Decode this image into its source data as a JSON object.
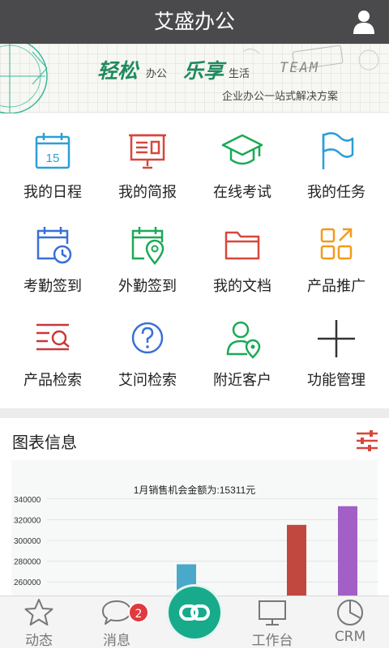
{
  "header": {
    "title": "艾盛办公",
    "user_icon": "user-icon"
  },
  "banner": {
    "word1": "轻松",
    "sub1": "办公",
    "word2": "乐享",
    "sub2": "生活",
    "team": "TEAM",
    "tagline": "企业办公一站式解决方案"
  },
  "grid": {
    "items": [
      {
        "label": "我的日程",
        "icon": "calendar-icon",
        "day": "15",
        "color": "#2b9fd8"
      },
      {
        "label": "我的简报",
        "icon": "presentation-icon",
        "color": "#d8463b"
      },
      {
        "label": "在线考试",
        "icon": "graduation-cap-icon",
        "color": "#1aaa55"
      },
      {
        "label": "我的任务",
        "icon": "flag-icon",
        "color": "#2b9fd8"
      },
      {
        "label": "考勤签到",
        "icon": "calendar-clock-icon",
        "color": "#3a6fd8"
      },
      {
        "label": "外勤签到",
        "icon": "calendar-location-icon",
        "color": "#1aaa55"
      },
      {
        "label": "我的文档",
        "icon": "folder-icon",
        "color": "#d8463b"
      },
      {
        "label": "产品推广",
        "icon": "apps-grid-icon",
        "color": "#f39a1e"
      },
      {
        "label": "产品检索",
        "icon": "list-search-icon",
        "color": "#c9383a"
      },
      {
        "label": "艾问检索",
        "icon": "question-circle-icon",
        "color": "#3a6fd8"
      },
      {
        "label": "附近客户",
        "icon": "person-location-icon",
        "color": "#1aaa55"
      },
      {
        "label": "功能管理",
        "icon": "plus-icon",
        "color": "#333333"
      }
    ]
  },
  "chart_section": {
    "title": "图表信息",
    "filter_icon": "sliders-icon"
  },
  "chart_data": {
    "type": "bar",
    "title": "1月销售机会金额为:15311元",
    "ylim": [
      250000,
      350000
    ],
    "yticks": [
      260000,
      280000,
      300000,
      320000,
      340000
    ],
    "ytick_labels": [
      "260000",
      "280000",
      "300000",
      "320000",
      "340000"
    ],
    "values": [
      277000,
      315000,
      333000
    ],
    "colors": [
      "#4aa8c9",
      "#c0483e",
      "#a25fc6"
    ],
    "grid": true
  },
  "tabbar": {
    "tabs": [
      {
        "label": "动态",
        "icon": "star-icon"
      },
      {
        "label": "消息",
        "icon": "chat-bubble-icon"
      },
      {
        "label": "工作台",
        "icon": "monitor-icon"
      },
      {
        "label": "CRM",
        "icon": "pie-chart-icon"
      }
    ],
    "badge": "2",
    "center_icon": "link-icon",
    "accent": "#17ab8c"
  }
}
